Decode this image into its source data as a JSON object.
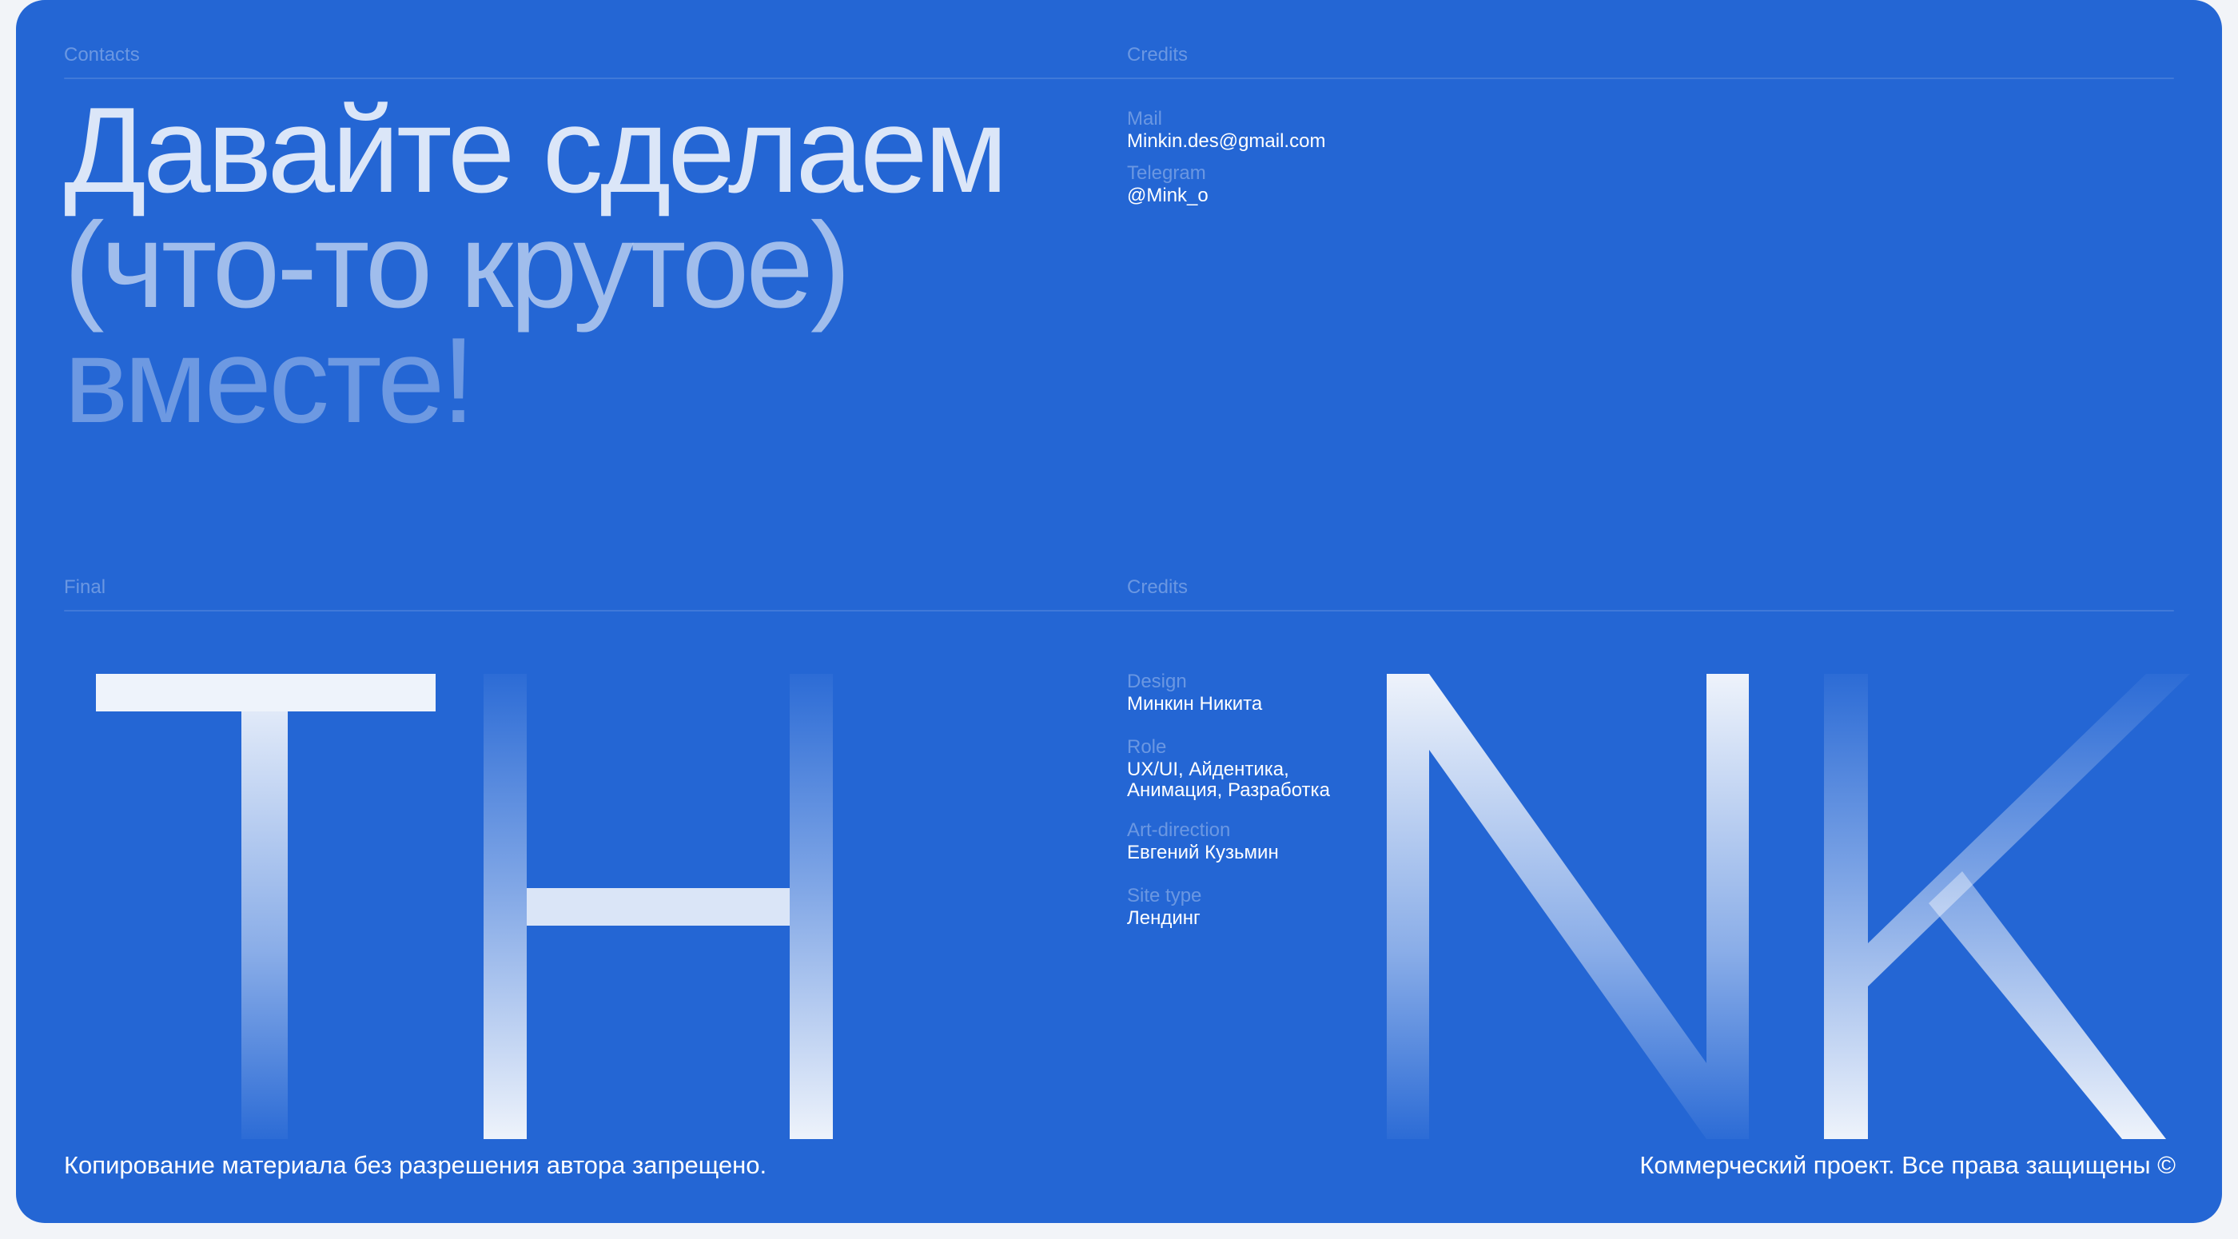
{
  "sections": {
    "contacts_label": "Contacts",
    "credits_top_label": "Credits",
    "final_label": "Final",
    "credits_bottom_label": "Credits"
  },
  "headline": {
    "line1": "Давайте сделаем",
    "line2": "(что-то крутое)",
    "line3": "вместе!"
  },
  "contacts": {
    "mail_label": "Mail",
    "mail_value": "Minkin.des@gmail.com",
    "telegram_label": "Telegram",
    "telegram_value": "@Mink_o"
  },
  "credits": {
    "design_label": "Design",
    "design_value": "Минкин Никита",
    "role_label": "Role",
    "role_value": "UX/UI, Айдентика,\nАнимация, Разработка",
    "art_direction_label": "Art-direction",
    "art_direction_value": "Евгений Кузьмин",
    "site_type_label": "Site type",
    "site_type_value": "Лендинг"
  },
  "big_letters": [
    "T",
    "H",
    "N",
    "K"
  ],
  "footer": {
    "left": "Копирование материала без разрешения автора запрещено.",
    "right": "Коммерческий проект. Все права защищены ©"
  },
  "colors": {
    "background": "#2466d4",
    "page": "#f2f4f8",
    "letter_light": "#eef3fb"
  }
}
